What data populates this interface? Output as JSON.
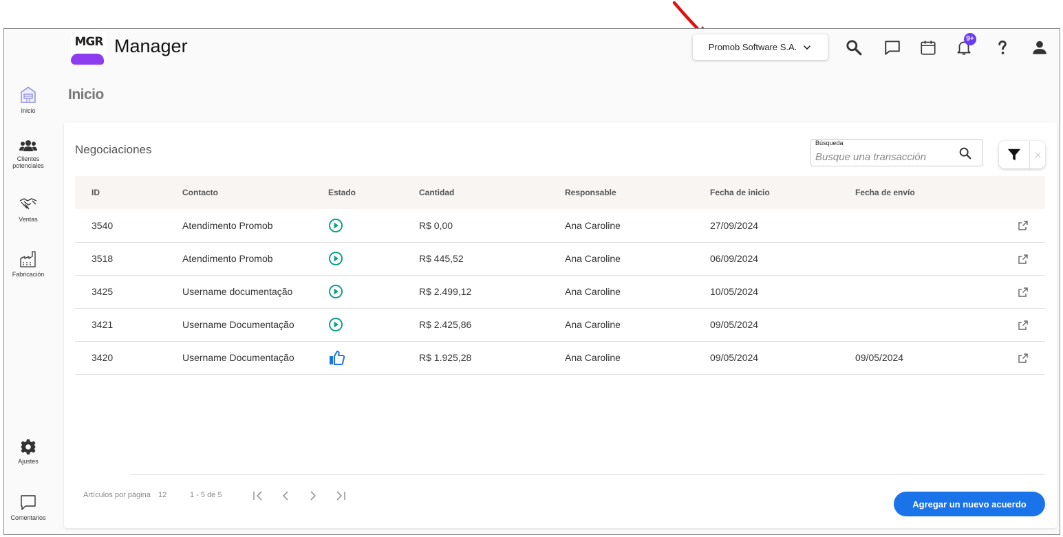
{
  "app": {
    "logo_text": "MGR",
    "title": "Manager"
  },
  "header": {
    "company": "Promob Software S.A.",
    "notifications_badge": "9+"
  },
  "sidebar": {
    "items": [
      {
        "label": "Inicio"
      },
      {
        "label": "Clientes potenciales"
      },
      {
        "label": "Ventas"
      },
      {
        "label": "Fabricación"
      }
    ],
    "bottom": [
      {
        "label": "Ajustes"
      },
      {
        "label": "Comentarios"
      }
    ]
  },
  "page": {
    "title": "Inicio"
  },
  "card": {
    "title": "Negociaciones",
    "search": {
      "label": "Búsqueda",
      "placeholder": "Busque una transacción"
    },
    "columns": [
      "ID",
      "Contacto",
      "Estado",
      "Cantidad",
      "Responsable",
      "Fecha de inicio",
      "Fecha de envío"
    ],
    "rows": [
      {
        "id": "3540",
        "contact": "Atendimento Promob",
        "status": "in-progress",
        "amount": "R$ 0,00",
        "owner": "Ana Caroline",
        "start": "27/09/2024",
        "sent": ""
      },
      {
        "id": "3518",
        "contact": "Atendimento Promob",
        "status": "in-progress",
        "amount": "R$ 445,52",
        "owner": "Ana Caroline",
        "start": "06/09/2024",
        "sent": ""
      },
      {
        "id": "3425",
        "contact": "Username documentação",
        "status": "in-progress",
        "amount": "R$ 2.499,12",
        "owner": "Ana Caroline",
        "start": "10/05/2024",
        "sent": ""
      },
      {
        "id": "3421",
        "contact": "Username Documentação",
        "status": "in-progress",
        "amount": "R$ 2.425,86",
        "owner": "Ana Caroline",
        "start": "09/05/2024",
        "sent": ""
      },
      {
        "id": "3420",
        "contact": "Username Documentação",
        "status": "approved",
        "amount": "R$ 1.925,28",
        "owner": "Ana Caroline",
        "start": "09/05/2024",
        "sent": "09/05/2024"
      }
    ],
    "pagination": {
      "per_page_label": "Artículos por página",
      "per_page": "12",
      "range": "1 - 5 de 5"
    },
    "add_button": "Agregar un nuevo acuerdo"
  },
  "colors": {
    "accent": "#1a73e8",
    "status_in_progress": "#15a085",
    "status_approved": "#1a73e8",
    "badge": "#6a3cf0",
    "annotation": "#e01010"
  }
}
